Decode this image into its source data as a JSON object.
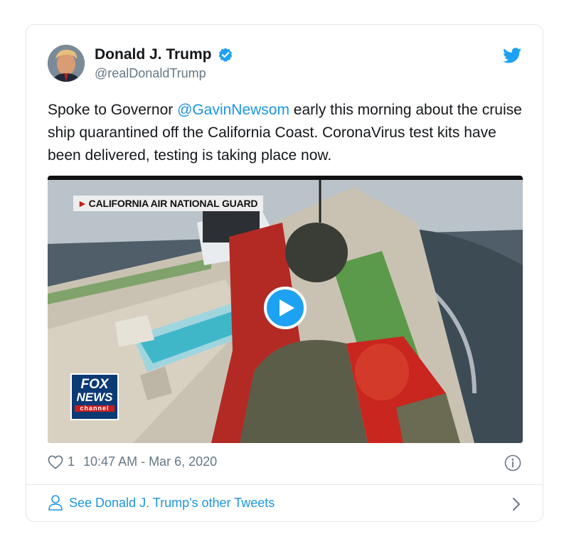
{
  "author": {
    "display_name": "Donald J. Trump",
    "handle": "@realDonaldTrump",
    "verified": true
  },
  "tweet": {
    "text_before": "Spoke to Governor ",
    "mention": "@GavinNewsom",
    "text_after": " early this morning about the cruise ship quarantined off the California Coast. CoronaVirus test kits have been delivered, testing is taking place now."
  },
  "media": {
    "chyron": "CALIFORNIA AIR NATIONAL GUARD",
    "network_logo_line1": "FOX",
    "network_logo_line2": "NEWS",
    "network_logo_line3": "channel"
  },
  "meta": {
    "likes": "1",
    "timestamp": "10:47 AM - Mar 6, 2020"
  },
  "footer": {
    "link_text": "See Donald J. Trump's other Tweets"
  },
  "icons": {
    "brand": "twitter-bird-icon",
    "verified": "verified-badge-icon",
    "play": "play-icon",
    "like": "heart-icon",
    "info": "info-icon",
    "profile": "person-icon",
    "chevron": "chevron-right-icon"
  },
  "colors": {
    "accent": "#1da1f2",
    "link": "#1b95e0",
    "muted": "#657786",
    "border": "#e1e8ed",
    "fox_blue": "#0b3a74",
    "fox_red": "#c81d1d"
  }
}
